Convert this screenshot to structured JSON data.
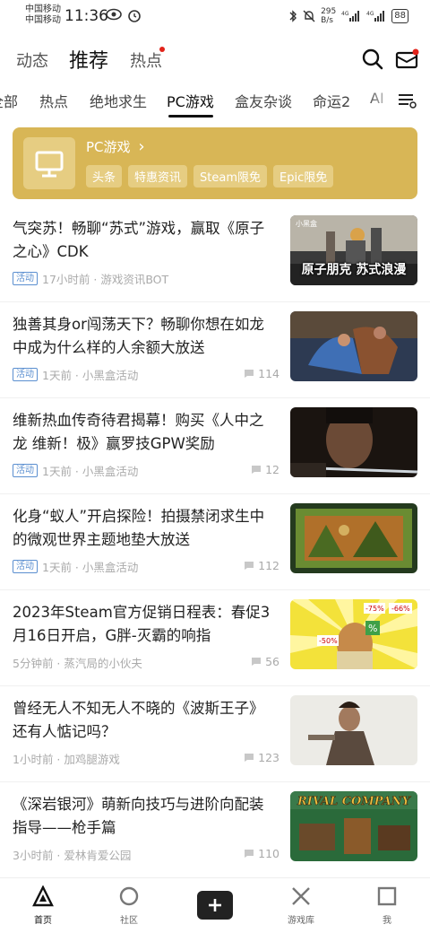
{
  "status_bar": {
    "carrier_1": "中国移动",
    "carrier_2": "中国移动",
    "time": "11:36",
    "speed_top": "295",
    "speed_unit": "B/s",
    "battery": "88"
  },
  "top_tabs": [
    "动态",
    "推荐",
    "热点"
  ],
  "channels": [
    "全部",
    "热点",
    "绝地求生",
    "PC游戏",
    "盒友杂谈",
    "命运2",
    "AI"
  ],
  "banner": {
    "title": "PC游戏",
    "arrow": "›",
    "tags": [
      "头条",
      "特惠资讯",
      "Steam限免",
      "Epic限免"
    ]
  },
  "feed": [
    {
      "title": "气突苏！畅聊“苏式”游戏，赢取《原子之心》CDK",
      "badge": "活动",
      "meta": "17小时前 · 游戏资讯BOT",
      "comments": "",
      "thumb_caption": "原子朋克 苏式浪漫",
      "thumb_brand": "小黑盒"
    },
    {
      "title": "独善其身or闯荡天下？畅聊你想在如龙中成为什么样的人余额大放送",
      "badge": "活动",
      "meta": "1天前 · 小黑盒活动",
      "comments": "114",
      "thumb_caption": "",
      "thumb_brand": ""
    },
    {
      "title": "维新热血传奇待君揭幕！购买《人中之龙 维新！极》赢罗技GPW奖励",
      "badge": "活动",
      "meta": "1天前 · 小黑盒活动",
      "comments": "12",
      "thumb_caption": "",
      "thumb_brand": ""
    },
    {
      "title": "化身“蚁人”开启探险！拍摄禁闭求生中的微观世界主题地垫大放送",
      "badge": "活动",
      "meta": "1天前 · 小黑盒活动",
      "comments": "112",
      "thumb_caption": "",
      "thumb_brand": ""
    },
    {
      "title": "2023年Steam官方促销日程表：春促3月16日开启，G胖-灭霸的响指",
      "badge": "",
      "meta": "5分钟前 · 蒸汽局的小伙夫",
      "comments": "56",
      "thumb_caption": "",
      "thumb_brand": "",
      "thumb_tags": [
        "-75%",
        "-66%",
        "%",
        "-50%"
      ]
    },
    {
      "title": "曾经无人不知无人不晓的《波斯王子》还有人惦记吗？",
      "badge": "",
      "meta": "1小时前 · 加鸡腿游戏",
      "comments": "123",
      "thumb_caption": "",
      "thumb_brand": ""
    },
    {
      "title": "《深岩银河》萌新向技巧与进阶向配装指导——枪手篇",
      "badge": "",
      "meta": "3小时前 · 爱林肯爱公园",
      "comments": "110",
      "thumb_caption": "RIVAL COMPANY",
      "thumb_brand": ""
    }
  ],
  "bottom_nav": [
    "首页",
    "社区",
    "游戏库",
    "我"
  ],
  "colors": {
    "banner_bg": "#d8b656",
    "badge_blue": "#5b8fd0",
    "red_dot": "#e2231a"
  },
  "icons": [
    "search-icon",
    "mail-icon",
    "menu-settings-icon",
    "monitor-icon",
    "home-icon",
    "community-icon",
    "plus-icon",
    "game-library-icon",
    "profile-icon"
  ]
}
